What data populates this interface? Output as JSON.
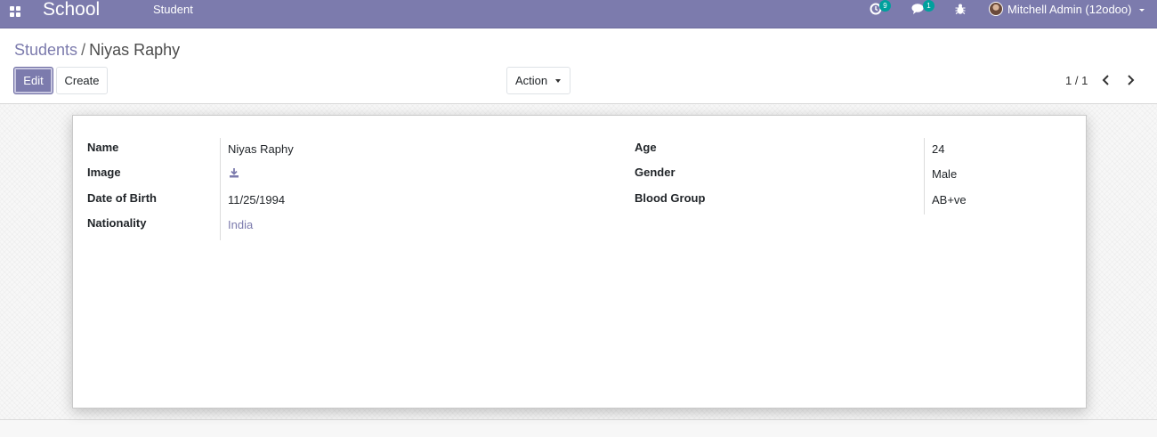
{
  "navbar": {
    "brand": "School",
    "menu_student": "Student",
    "activity_count": "9",
    "message_count": "1",
    "user_name": "Mitchell Admin (12odoo)"
  },
  "breadcrumb": {
    "parent": "Students",
    "separator": "/",
    "current": "Niyas Raphy"
  },
  "buttons": {
    "edit": "Edit",
    "create": "Create",
    "action": "Action"
  },
  "pager": {
    "value": "1 / 1"
  },
  "form": {
    "left": [
      {
        "label": "Name",
        "value": "Niyas Raphy"
      },
      {
        "label": "Image",
        "value": "download-icon"
      },
      {
        "label": "Date of Birth",
        "value": "11/25/1994"
      },
      {
        "label": "Nationality",
        "value": "India"
      }
    ],
    "right": [
      {
        "label": "Age",
        "value": "24"
      },
      {
        "label": "Gender",
        "value": "Male"
      },
      {
        "label": "Blood Group",
        "value": "AB+ve"
      }
    ]
  },
  "colors": {
    "brand": "#7c7bad",
    "badge": "#00a09d"
  }
}
